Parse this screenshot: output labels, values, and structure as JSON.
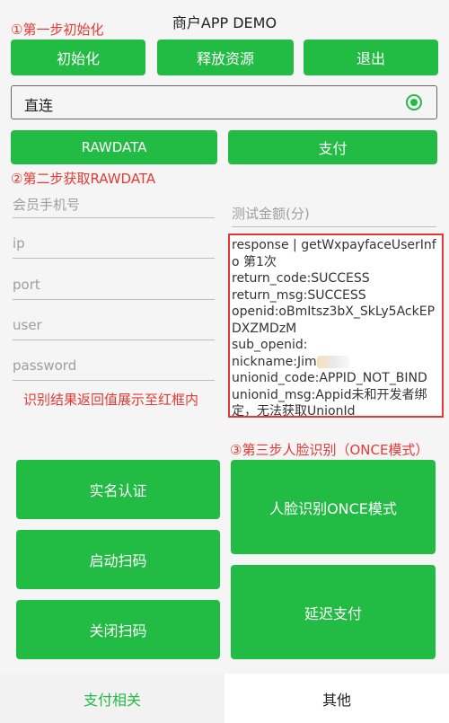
{
  "header": {
    "title": "商户APP DEMO"
  },
  "annotations": {
    "step1": "①第一步初始化",
    "step2": "②第二步获取RAWDATA",
    "step3": "③第三步人脸识别（ONCE模式）",
    "result_hint": "识别结果返回值展示至红框内"
  },
  "top_buttons": {
    "init": "初始化",
    "release": "释放资源",
    "exit": "退出"
  },
  "connection": {
    "label": "直连",
    "selected": true
  },
  "actions": {
    "rawdata": "RAWDATA",
    "pay": "支付"
  },
  "fields": {
    "member_phone": "会员手机号",
    "ip": "ip",
    "port": "port",
    "user": "user",
    "password": "password",
    "test_amount": "测试金额(分)"
  },
  "response": {
    "line1": "response | getWxpayfaceUserInfo 第1次",
    "line2": "return_code:SUCCESS",
    "line3": "return_msg:SUCCESS",
    "line4": "openid:oBmItsz3bX_SkLy5AckEPDXZMDzM",
    "line5": "sub_openid:",
    "line6": "nickname:Jim",
    "line7": "unionid_code:APPID_NOT_BIND",
    "line8": "unionid_msg:Appid未和开发者绑定，无法获取UnionId"
  },
  "left_buttons": {
    "realname": "实名认证",
    "start_scan": "启动扫码",
    "close_scan": "关闭扫码"
  },
  "right_buttons": {
    "face_once": "人脸识别ONCE模式",
    "delay_pay": "延迟支付"
  },
  "tabs": {
    "left": "支付相关",
    "right": "其他"
  },
  "colors": {
    "accent": "#22bb44",
    "annotation": "#e53935"
  }
}
